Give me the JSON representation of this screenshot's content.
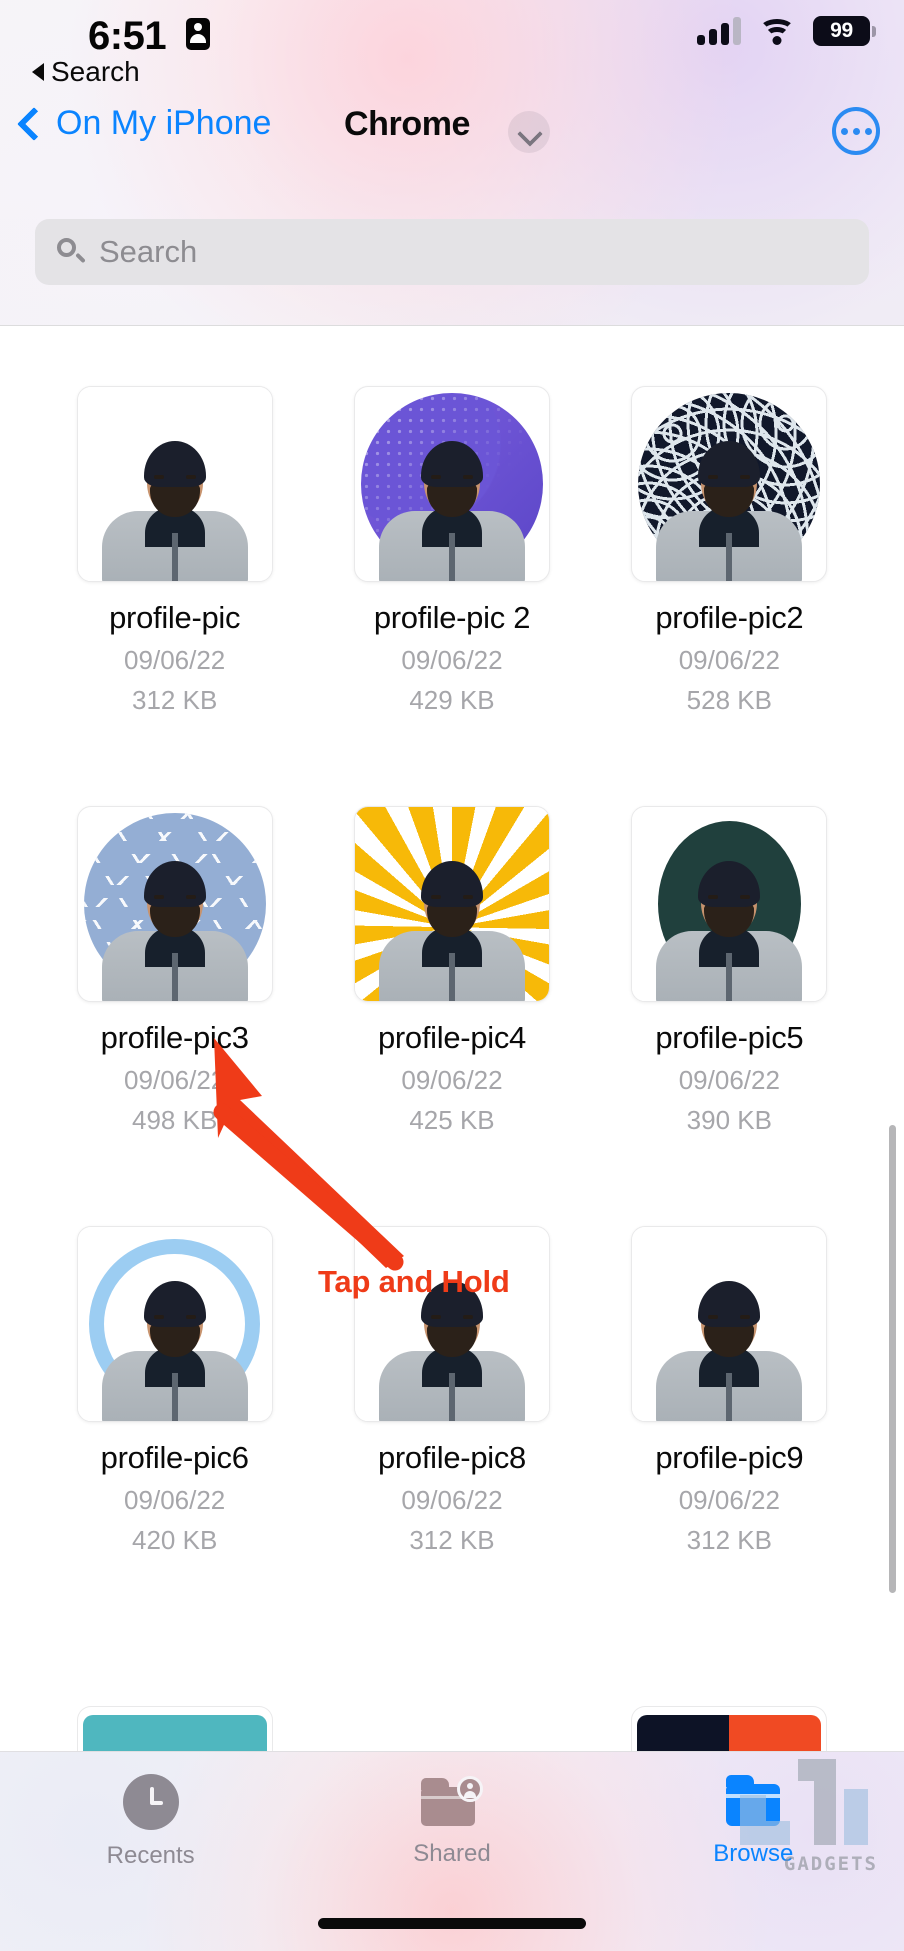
{
  "status_bar": {
    "time": "6:51",
    "id_card_icon": "contact-card-icon",
    "signal_icon": "cellular-signal-icon",
    "wifi_icon": "wifi-icon",
    "battery_level": "99",
    "back_app_label": "Search",
    "back_app_icon": "triangle-left-icon"
  },
  "nav": {
    "back_label": "On My iPhone",
    "back_icon": "chevron-left-icon",
    "title": "Chrome",
    "dropdown_icon": "chevron-down-icon",
    "more_icon": "ellipsis-circle-icon",
    "accent_color": "#0a84ff"
  },
  "search": {
    "placeholder": "Search",
    "value": "",
    "icon": "search-icon"
  },
  "files": [
    {
      "name": "profile-pic",
      "date": "09/06/22",
      "size": "312 KB",
      "art": "bg-plain",
      "shape": "square"
    },
    {
      "name": "profile-pic 2",
      "date": "09/06/22",
      "size": "429 KB",
      "art": "bg-halftone",
      "shape": "circle"
    },
    {
      "name": "profile-pic2",
      "date": "09/06/22",
      "size": "528 KB",
      "art": "bg-maze",
      "shape": "circle"
    },
    {
      "name": "profile-pic3",
      "date": "09/06/22",
      "size": "498 KB",
      "art": "bg-confetti",
      "shape": "circle"
    },
    {
      "name": "profile-pic4",
      "date": "09/06/22",
      "size": "425 KB",
      "art": "bg-sunburst",
      "shape": "square"
    },
    {
      "name": "profile-pic5",
      "date": "09/06/22",
      "size": "390 KB",
      "art": "bg-teal-circle",
      "shape": "square"
    },
    {
      "name": "profile-pic6",
      "date": "09/06/22",
      "size": "420 KB",
      "art": "bg-ring",
      "shape": "square"
    },
    {
      "name": "profile-pic8",
      "date": "09/06/22",
      "size": "312 KB",
      "art": "bg-plain",
      "shape": "square"
    },
    {
      "name": "profile-pic9",
      "date": "09/06/22",
      "size": "312 KB",
      "art": "bg-plain",
      "shape": "square"
    }
  ],
  "annotation": {
    "caption": "Tap and Hold",
    "color": "#ef3b18",
    "arrow_icon": "arrow-pointer-icon",
    "points_to": "profile-pic3"
  },
  "tab_bar": {
    "items": [
      {
        "label": "Recents",
        "icon": "clock-icon",
        "active": false
      },
      {
        "label": "Shared",
        "icon": "shared-folder-icon",
        "active": false
      },
      {
        "label": "Browse",
        "icon": "folder-icon",
        "active": true
      }
    ],
    "active_color": "#0a84ff",
    "inactive_color": "#8e8a93"
  },
  "watermark": {
    "text": "GADGETS"
  }
}
